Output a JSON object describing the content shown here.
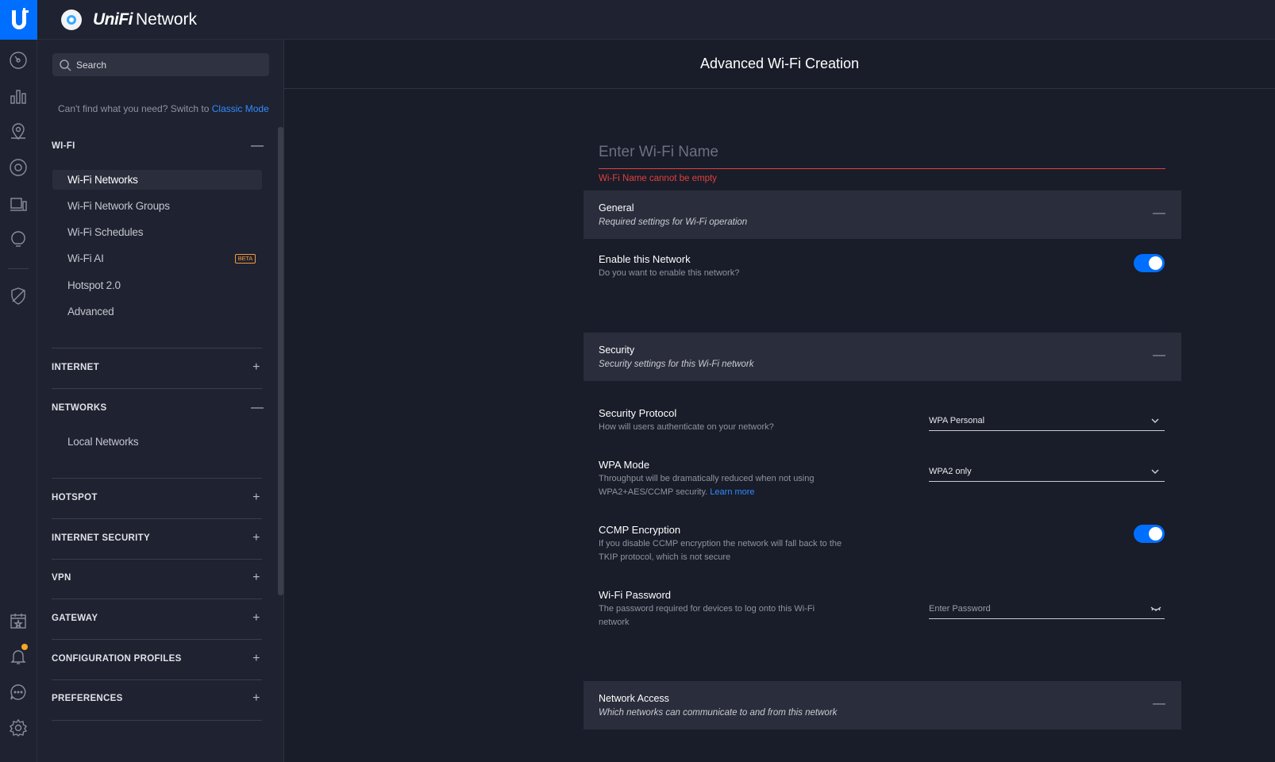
{
  "app": {
    "brand_prefix": "UniFi",
    "brand_name": "Network"
  },
  "rail": {
    "items": [
      {
        "name": "dashboard-icon"
      },
      {
        "name": "statistics-icon"
      },
      {
        "name": "map-icon"
      },
      {
        "name": "devices-icon"
      },
      {
        "name": "clients-icon"
      },
      {
        "name": "insights-icon"
      },
      {
        "name": "security-shield-icon"
      },
      {
        "name": "events-calendar-icon"
      },
      {
        "name": "notifications-bell-icon"
      },
      {
        "name": "chat-icon"
      },
      {
        "name": "settings-gear-icon"
      }
    ],
    "notification_color": "#f5a623"
  },
  "sidebar": {
    "search_placeholder": "Search",
    "classic_prefix": "Can't find what you need? Switch to",
    "classic_link": "Classic Mode",
    "wifi": {
      "label": "WI-FI",
      "toggle": "—",
      "items": [
        {
          "label": "Wi-Fi Networks"
        },
        {
          "label": "Wi-Fi Network Groups"
        },
        {
          "label": "Wi-Fi Schedules"
        },
        {
          "label": "Wi-Fi AI",
          "badge": "BETA"
        },
        {
          "label": "Hotspot 2.0"
        },
        {
          "label": "Advanced"
        }
      ]
    },
    "internet": {
      "label": "INTERNET",
      "toggle": "+"
    },
    "networks": {
      "label": "NETWORKS",
      "toggle": "—",
      "items": [
        {
          "label": "Local Networks"
        }
      ]
    },
    "hotspot": {
      "label": "HOTSPOT",
      "toggle": "+"
    },
    "internet_security": {
      "label": "INTERNET SECURITY",
      "toggle": "+"
    },
    "vpn": {
      "label": "VPN",
      "toggle": "+"
    },
    "gateway": {
      "label": "GATEWAY",
      "toggle": "+"
    },
    "config_profiles": {
      "label": "CONFIGURATION PROFILES",
      "toggle": "+"
    },
    "preferences": {
      "label": "PREFERENCES",
      "toggle": "+"
    }
  },
  "main": {
    "title": "Advanced Wi-Fi Creation",
    "name_placeholder": "Enter Wi-Fi Name",
    "name_error": "Wi-Fi Name cannot be empty",
    "general": {
      "title": "General",
      "subtitle": "Required settings for Wi-Fi operation",
      "toggle": "—"
    },
    "enable": {
      "title": "Enable this Network",
      "desc": "Do you want to enable this network?",
      "on": true
    },
    "security": {
      "title": "Security",
      "subtitle": "Security settings for this Wi-Fi network",
      "toggle": "—"
    },
    "protocol": {
      "title": "Security Protocol",
      "desc": "How will users authenticate on your network?",
      "value": "WPA Personal"
    },
    "wpa_mode": {
      "title": "WPA Mode",
      "desc": "Throughput will be dramatically reduced when not using WPA2+AES/CCMP security.",
      "link": "Learn more",
      "value": "WPA2 only"
    },
    "ccmp": {
      "title": "CCMP Encryption",
      "desc": "If you disable CCMP encryption the network will fall back to the TKIP protocol, which is not secure",
      "on": true
    },
    "password": {
      "title": "Wi-Fi Password",
      "desc": "The password required for devices to log onto this Wi-Fi network",
      "placeholder": "Enter Password"
    },
    "network_access": {
      "title": "Network Access",
      "subtitle": "Which networks can communicate to and from this network",
      "toggle": "—"
    }
  },
  "colors": {
    "accent": "#006fff",
    "link": "#2f8cff",
    "error": "#e2403c",
    "beta": "#f39a3d"
  }
}
